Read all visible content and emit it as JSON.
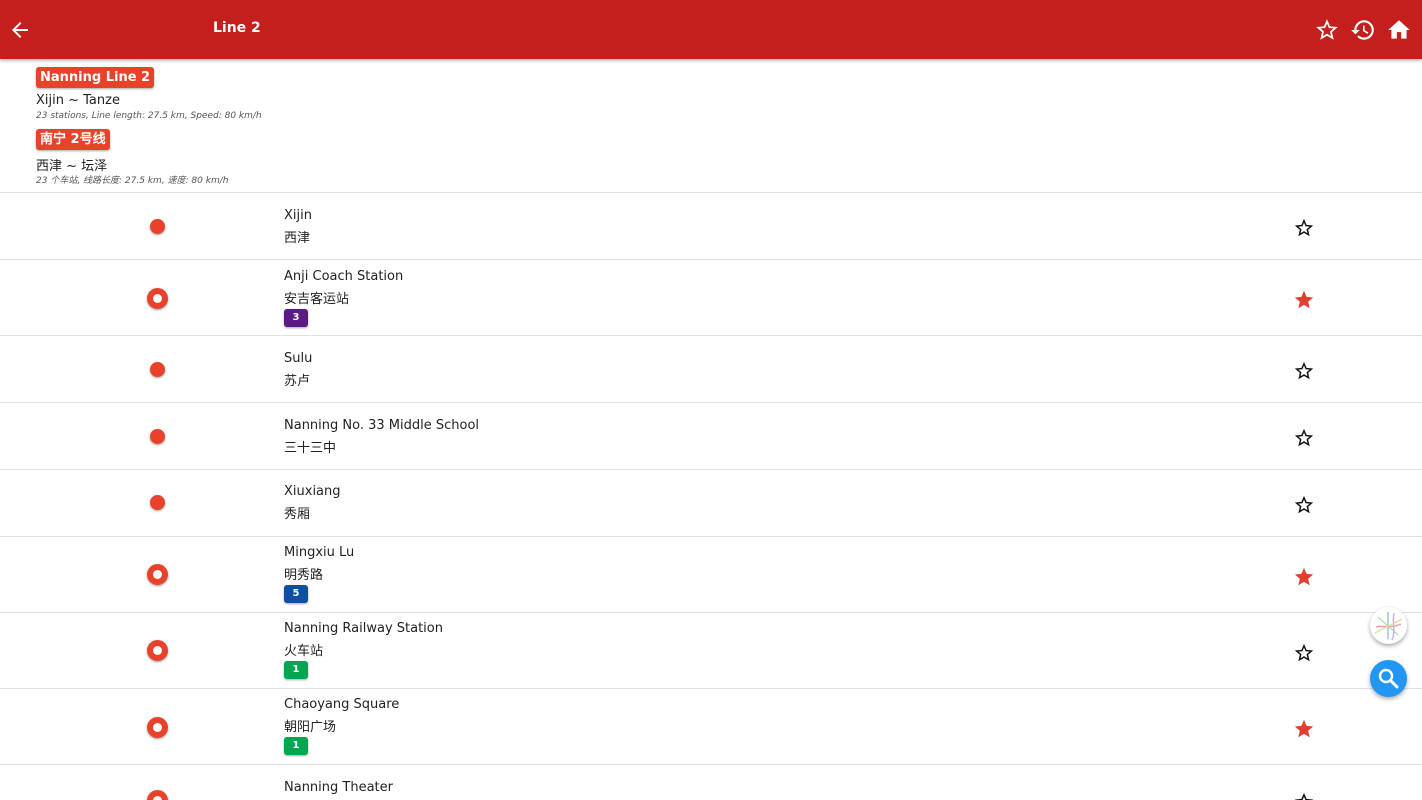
{
  "appbar": {
    "title": "Line 2",
    "icons": [
      "arrow-back-icon",
      "star-outline-icon",
      "history-icon",
      "home-icon"
    ]
  },
  "line": {
    "name_en": "Nanning Line 2",
    "route_en": "Xijin ~ Tanze",
    "info_en": "23 stations, Line length: 27.5 km, Speed: 80 km/h",
    "name_zh": "南宁 2号线",
    "route_zh": "西津 ~ 坛泽",
    "info_zh": "23 个车站, 线路长度: 27.5 km, 速度: 80 km/h",
    "color": "#e8432a"
  },
  "stations": [
    {
      "en": "Xijin",
      "zh": "西津",
      "transfer": null,
      "favorite": false
    },
    {
      "en": "Anji Coach Station",
      "zh": "安吉客运站",
      "transfer": {
        "line": "3",
        "color": "#5b1a86"
      },
      "favorite": true
    },
    {
      "en": "Sulu",
      "zh": "苏卢",
      "transfer": null,
      "favorite": false
    },
    {
      "en": "Nanning No. 33 Middle School",
      "zh": "三十三中",
      "transfer": null,
      "favorite": false
    },
    {
      "en": "Xiuxiang",
      "zh": "秀厢",
      "transfer": null,
      "favorite": false
    },
    {
      "en": "Mingxiu Lu",
      "zh": "明秀路",
      "transfer": {
        "line": "5",
        "color": "#0d4fa0"
      },
      "favorite": true
    },
    {
      "en": "Nanning Railway Station",
      "zh": "火车站",
      "transfer": {
        "line": "1",
        "color": "#00a651"
      },
      "favorite": false
    },
    {
      "en": "Chaoyang Square",
      "zh": "朝阳广场",
      "transfer": {
        "line": "1",
        "color": "#00a651"
      },
      "favorite": true
    },
    {
      "en": "Nanning Theater",
      "zh": "",
      "transfer": null,
      "favorite": false
    }
  ],
  "fabs": [
    "metro-map-icon",
    "search-icon"
  ],
  "colors": {
    "appbar": "#c41f1c",
    "favorite": "#e0402f",
    "search_fab": "#2196f3"
  }
}
